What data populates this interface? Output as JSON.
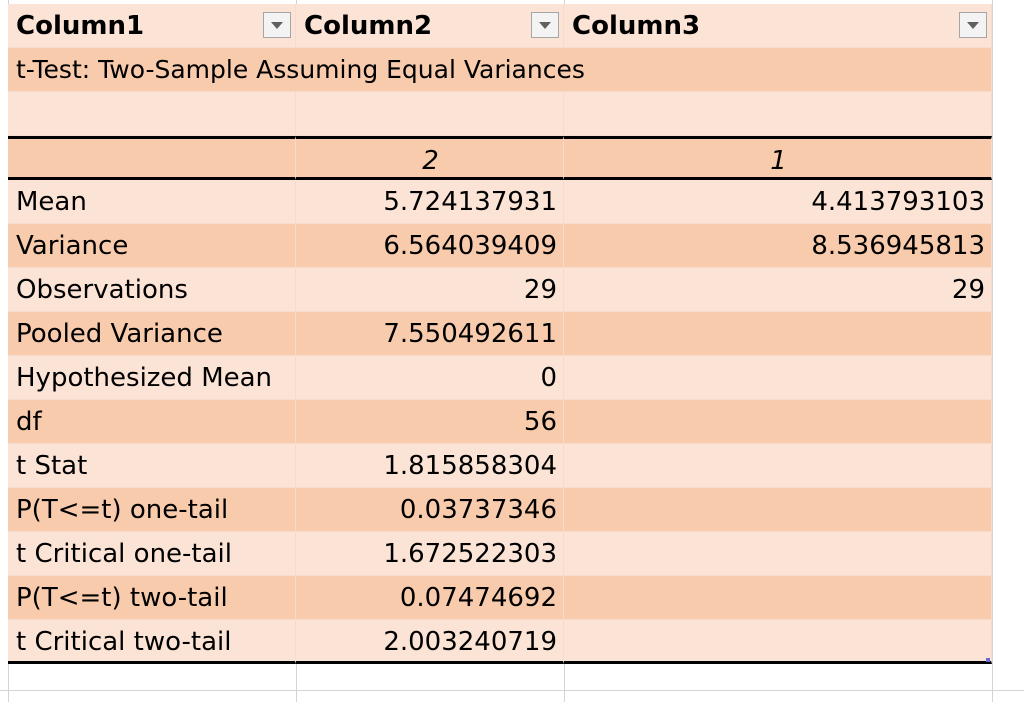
{
  "headers": [
    {
      "label": "Column1"
    },
    {
      "label": "Column2"
    },
    {
      "label": "Column3"
    }
  ],
  "title": "t-Test: Two-Sample Assuming Equal Variances",
  "subheader": {
    "col2": "2",
    "col3": "1"
  },
  "rows": [
    {
      "label": "Mean",
      "v1": "5.724137931",
      "v2": "4.413793103"
    },
    {
      "label": "Variance",
      "v1": "6.564039409",
      "v2": "8.536945813"
    },
    {
      "label": "Observations",
      "v1": "29",
      "v2": "29"
    },
    {
      "label": "Pooled Variance",
      "v1": "7.550492611",
      "v2": ""
    },
    {
      "label": "Hypothesized Mean",
      "v1": "0",
      "v2": ""
    },
    {
      "label": "df",
      "v1": "56",
      "v2": ""
    },
    {
      "label": "t Stat",
      "v1": "1.815858304",
      "v2": ""
    },
    {
      "label": "P(T<=t) one-tail",
      "v1": "0.03737346",
      "v2": ""
    },
    {
      "label": "t Critical one-tail",
      "v1": "1.672522303",
      "v2": ""
    },
    {
      "label": "P(T<=t) two-tail",
      "v1": "0.07474692",
      "v2": ""
    },
    {
      "label": "t Critical two-tail",
      "v1": "2.003240719",
      "v2": ""
    }
  ],
  "colors": {
    "band_light": "#fbe4d6",
    "band_dark": "#f8cbad",
    "gridline": "#d4d4d4"
  },
  "icons": {
    "filter": "filter-dropdown-icon"
  }
}
